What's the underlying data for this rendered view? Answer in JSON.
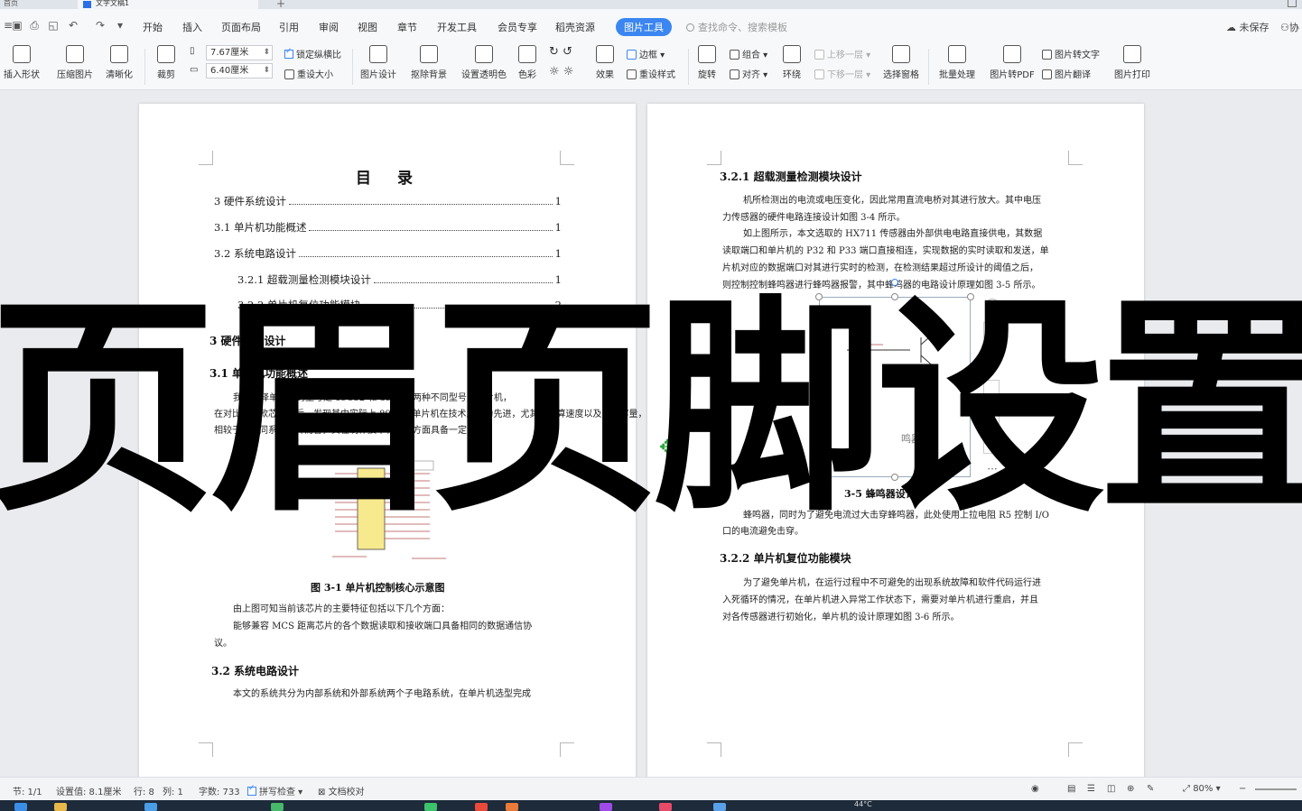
{
  "titlebar": {
    "home_tab": "首页",
    "doc_tab": "文字文稿1"
  },
  "menu": {
    "items": [
      "开始",
      "插入",
      "页面布局",
      "引用",
      "审阅",
      "视图",
      "章节",
      "开发工具",
      "会员专享",
      "稻壳资源"
    ],
    "active": "图片工具",
    "search_placeholder": "查找命令、搜索模板",
    "unsaved": "未保存",
    "collab": "协"
  },
  "ribbon": {
    "insert_shape": "插入形状",
    "compress": "压缩图片",
    "sharpen": "清晰化",
    "crop": "裁剪",
    "width_value": "7.67厘米",
    "height_value": "6.40厘米",
    "lock_ratio": "锁定纵横比",
    "reset_size": "重设大小",
    "picture_design": "图片设计",
    "remove_bg": "抠除背景",
    "set_transparent": "设置透明色",
    "color": "色彩",
    "effect": "效果",
    "border": "边框",
    "reset_style": "重设样式",
    "rotate": "旋转",
    "group": "组合",
    "align": "对齐",
    "wrap": "环绕",
    "bring_forward": "上移一层",
    "send_backward": "下移一层",
    "selection_pane": "选择窗格",
    "batch": "批量处理",
    "to_pdf": "图片转PDF",
    "to_text": "图片转文字",
    "translate": "图片翻译",
    "print": "图片打印"
  },
  "left_page": {
    "toc_title": "目　录",
    "toc": [
      {
        "text": "3 硬件系统设计",
        "page": "1"
      },
      {
        "text": "3.1  单片机功能概述",
        "page": "1"
      },
      {
        "text": "3.2 系统电路设计",
        "page": "1"
      },
      {
        "text": "3.2.1 超载测量检测模块设计",
        "page": "1"
      },
      {
        "text": "3.2.2 单片机复位功能模块",
        "page": "2"
      }
    ],
    "h3": "3 硬件系统设计",
    "h31": "3.1  单片机功能概述",
    "p1": "我们选择单片机的型号是 89C52 和 89C51 两种不同型号的单片机，",
    "p2": "在对比了两款芯片之后，发现其中实际上 89C52 单片机在技术上更为先进，尤其是运算速度以及内存容量，",
    "p3": "相较于其他同系列芯片而言，其在制作技术和成本方面具备一定优势。",
    "fig_caption": "图 3-1  单片机控制核心示意图",
    "p4": "由上图可知当前该芯片的主要特征包括以下几个方面：",
    "p5": "能够兼容 MCS 距离芯片的各个数据读取和接收端口具备相同的数据通信协",
    "p5b": "议。",
    "h32": "3.2 系统电路设计",
    "p6": "本文的系统共分为内部系统和外部系统两个子电路系统，在单片机选型完成"
  },
  "right_page": {
    "h321": "3.2.1 超载测量检测模块设计",
    "p1": "机所检测出的电流或电压变化，因此常用直流电桥对其进行放大。其中电压",
    "p1b": "力传感器的硬件电路连接设计如图 3-4 所示。",
    "p2": "如上图所示，本文选取的 HX711 传感器由外部供电电路直接供电，其数据",
    "p2b": "读取端口和单片机的 P32 和 P33 端口直接相连，实现数据的实时读取和发送，单",
    "p2c": "片机对应的数据端口对其进行实时的检测，在检测结果超过所设计的阈值之后，",
    "p2d": "则控制控制蜂鸣器进行蜂鸣器报警，其中蜂鸣器的电路设计原理如图 3-5 所示。",
    "fig_caption": "3-5  蜂鸣器设计",
    "fig_label": "鸣器",
    "p3": "蜂鸣器，同时为了避免电流过大击穿蜂鸣器，此处使用上拉电阻 R5 控制 I/O",
    "p3b": "口的电流避免击穿。",
    "h322": "3.2.2 单片机复位功能模块",
    "p4": "为了避免单片机，在运行过程中不可避免的出现系统故障和软件代码运行进",
    "p4b": "入死循环的情况，在单片机进入异常工作状态下，需要对单片机进行重启，并且",
    "p4c": "对各传感器进行初始化，单片机的设计原理如图 3-6 所示。"
  },
  "status": {
    "section": "节: 1/1",
    "setting": "设置值: 8.1厘米",
    "row": "行: 8",
    "col": "列: 1",
    "words": "字数: 733",
    "spell": "拼写检查",
    "proof": "文档校对",
    "zoom": "80%"
  },
  "taskbar": {
    "temp": "44°C"
  },
  "overlay": {
    "title": "页眉页脚设置"
  }
}
